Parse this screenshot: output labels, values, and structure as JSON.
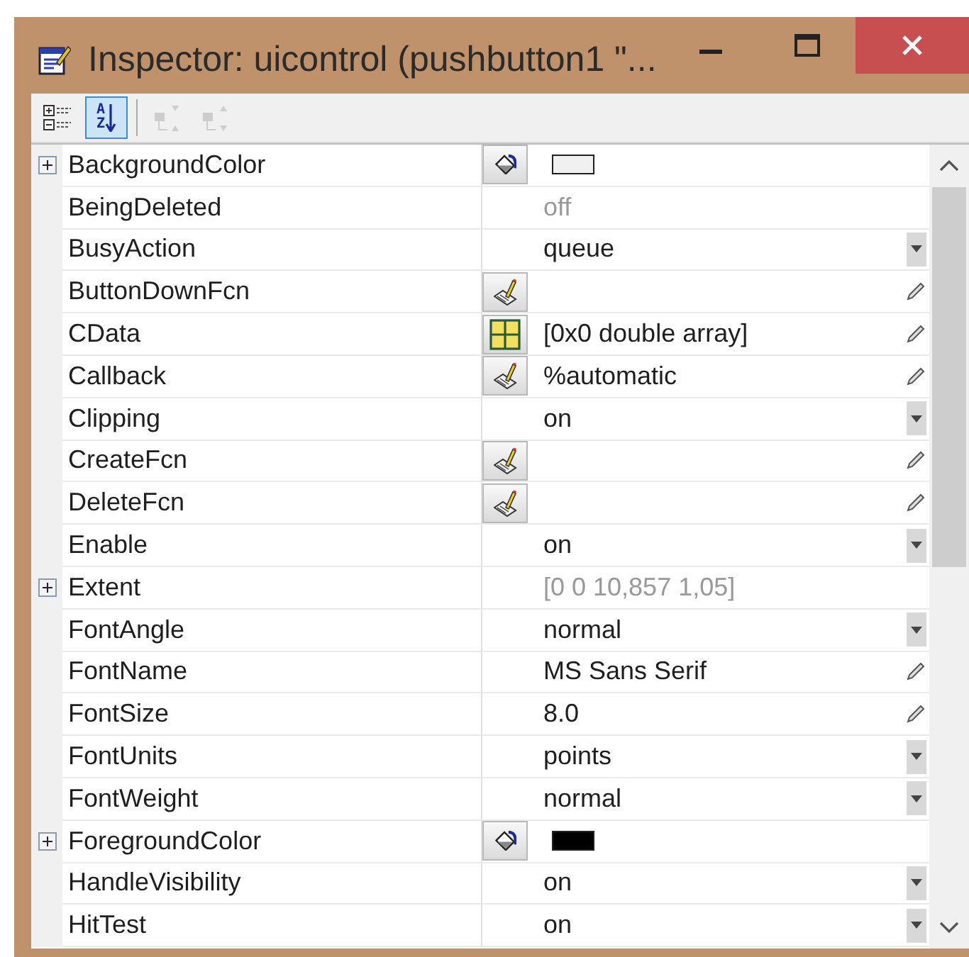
{
  "window": {
    "title": "Inspector:  uicontrol (pushbutton1 \"..."
  },
  "toolbar": {
    "buttons": [
      {
        "kind": "categorized",
        "selected": false,
        "disabled": false
      },
      {
        "kind": "alphabetical",
        "selected": true,
        "disabled": false,
        "label_top": "A",
        "label_bottom": "Z"
      },
      {
        "kind": "expand",
        "selected": false,
        "disabled": true
      },
      {
        "kind": "collapse",
        "selected": false,
        "disabled": true
      }
    ]
  },
  "properties": [
    {
      "name": "BackgroundColor",
      "expandable": true,
      "disabled": false,
      "button": {
        "kind": "color"
      },
      "swatch": {
        "color": "#f0f0f0"
      }
    },
    {
      "name": "BeingDeleted",
      "expandable": false,
      "disabled": true,
      "value": "off"
    },
    {
      "name": "BusyAction",
      "expandable": false,
      "disabled": false,
      "value": "queue",
      "editor": {
        "kind": "dropdown"
      }
    },
    {
      "name": "ButtonDownFcn",
      "expandable": false,
      "disabled": false,
      "button": {
        "kind": "callback"
      },
      "editor": {
        "kind": "pencil"
      }
    },
    {
      "name": "CData",
      "expandable": false,
      "disabled": false,
      "button": {
        "kind": "matrix"
      },
      "value": "[0x0  double array]",
      "editor": {
        "kind": "pencil"
      }
    },
    {
      "name": "Callback",
      "expandable": false,
      "disabled": false,
      "button": {
        "kind": "callback"
      },
      "value": "%automatic",
      "editor": {
        "kind": "pencil"
      }
    },
    {
      "name": "Clipping",
      "expandable": false,
      "disabled": false,
      "value": "on",
      "editor": {
        "kind": "dropdown"
      }
    },
    {
      "name": "CreateFcn",
      "expandable": false,
      "disabled": false,
      "button": {
        "kind": "callback"
      },
      "editor": {
        "kind": "pencil"
      }
    },
    {
      "name": "DeleteFcn",
      "expandable": false,
      "disabled": false,
      "button": {
        "kind": "callback"
      },
      "editor": {
        "kind": "pencil"
      }
    },
    {
      "name": "Enable",
      "expandable": false,
      "disabled": false,
      "value": "on",
      "editor": {
        "kind": "dropdown"
      }
    },
    {
      "name": "Extent",
      "expandable": true,
      "disabled": true,
      "value": "[0 0 10,857 1,05]"
    },
    {
      "name": "FontAngle",
      "expandable": false,
      "disabled": false,
      "value": "normal",
      "editor": {
        "kind": "dropdown"
      }
    },
    {
      "name": "FontName",
      "expandable": false,
      "disabled": false,
      "value": "MS Sans Serif",
      "editor": {
        "kind": "pencil"
      }
    },
    {
      "name": "FontSize",
      "expandable": false,
      "disabled": false,
      "value": "8.0",
      "editor": {
        "kind": "pencil"
      }
    },
    {
      "name": "FontUnits",
      "expandable": false,
      "disabled": false,
      "value": "points",
      "editor": {
        "kind": "dropdown"
      }
    },
    {
      "name": "FontWeight",
      "expandable": false,
      "disabled": false,
      "value": "normal",
      "editor": {
        "kind": "dropdown"
      }
    },
    {
      "name": "ForegroundColor",
      "expandable": true,
      "disabled": false,
      "button": {
        "kind": "color"
      },
      "swatch": {
        "color": "#000000"
      }
    },
    {
      "name": "HandleVisibility",
      "expandable": false,
      "disabled": false,
      "value": "on",
      "editor": {
        "kind": "dropdown"
      }
    },
    {
      "name": "HitTest",
      "expandable": false,
      "disabled": false,
      "value": "on",
      "editor": {
        "kind": "dropdown"
      }
    }
  ]
}
